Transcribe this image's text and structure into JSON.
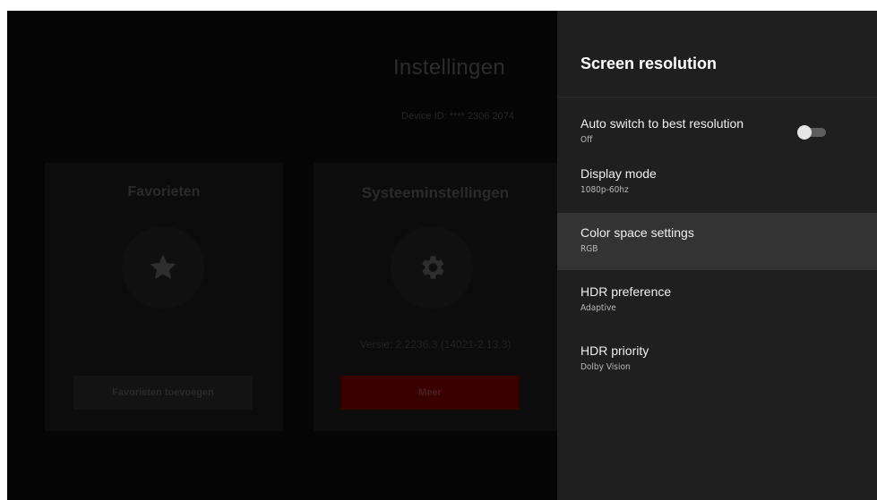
{
  "background_app": {
    "title": "Instellingen",
    "device_id": "Device ID: **** 2306 2074",
    "cards": {
      "favorites": {
        "title": "Favorieten",
        "icon": "star-icon",
        "button_label": "Favorieten toevoegen"
      },
      "system": {
        "title": "Systeeminstellingen",
        "icon": "gear-icon",
        "version": "Versie: 2.2236.3 (14021-2.13.3)",
        "button_label": "Meer"
      }
    }
  },
  "panel": {
    "title": "Screen resolution",
    "items": [
      {
        "label": "Auto switch to best resolution",
        "value": "Off",
        "toggle": false
      },
      {
        "label": "Display mode",
        "value": "1080p-60hz"
      },
      {
        "label": "Color space settings",
        "value": "RGB",
        "selected": true
      },
      {
        "label": "HDR preference",
        "value": "Adaptive"
      },
      {
        "label": "HDR priority",
        "value": "Dolby Vision"
      }
    ]
  },
  "colors": {
    "panel_bg": "#1f1f1f",
    "selected_bg": "#333333",
    "accent_red": "#3a0000"
  }
}
